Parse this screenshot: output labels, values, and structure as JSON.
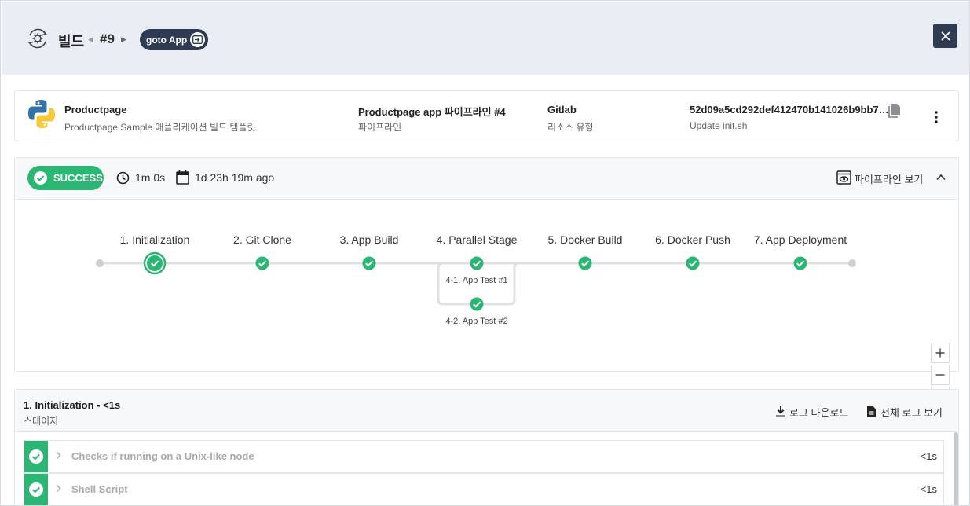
{
  "header": {
    "title": "빌드",
    "build_number": "#9",
    "goto_label": "goto App",
    "prev_icon": "caret-left-icon",
    "next_icon": "caret-right-icon",
    "close_icon": "close-icon"
  },
  "info": {
    "app_name": "Productpage",
    "app_desc": "Productpage Sample 애플리케이션 빌드 템플릿",
    "pipeline_name": "Productpage app 파이프라인 #4",
    "pipeline_label": "파이프라인",
    "resource_name": "Gitlab",
    "resource_label": "리소스 유형",
    "commit_hash": "52d09a5cd292def412470b141026b9bb7…",
    "commit_msg": "Update init.sh"
  },
  "status": {
    "badge": "SUCCESS",
    "duration": "1m 0s",
    "ago": "1d 23h 19m ago",
    "view_pipeline": "파이프라인 보기",
    "color": "#2cb673"
  },
  "pipeline": {
    "stages": [
      "1. Initialization",
      "2. Git Clone",
      "3. App Build",
      "4. Parallel Stage",
      "5. Docker Build",
      "6. Docker Push",
      "7. App Deployment"
    ],
    "parallel": [
      "4-1. App Test #1",
      "4-2. App Test #2"
    ]
  },
  "detail": {
    "title": "1. Initialization - <1s",
    "subtitle": "스테이지",
    "download_log": "로그 다운로드",
    "view_all_log": "전체 로그 보기",
    "steps": [
      {
        "name": "Checks if running on a Unix-like node",
        "duration": "<1s"
      },
      {
        "name": "Shell Script",
        "duration": "<1s"
      }
    ]
  }
}
